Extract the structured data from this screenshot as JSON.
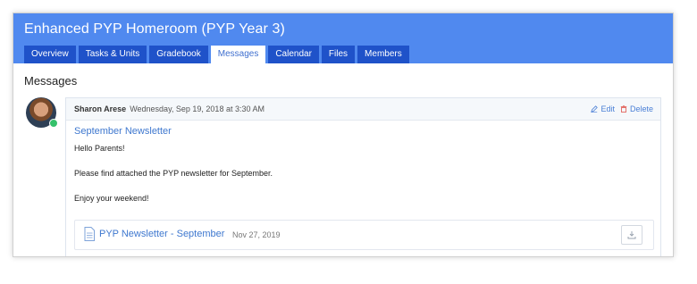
{
  "header": {
    "title": "Enhanced PYP Homeroom (PYP Year 3)",
    "tabs": [
      {
        "label": "Overview",
        "active": false
      },
      {
        "label": "Tasks & Units",
        "active": false
      },
      {
        "label": "Gradebook",
        "active": false
      },
      {
        "label": "Messages",
        "active": true
      },
      {
        "label": "Calendar",
        "active": false
      },
      {
        "label": "Files",
        "active": false
      },
      {
        "label": "Members",
        "active": false
      }
    ]
  },
  "main": {
    "section_title": "Messages",
    "message": {
      "author": "Sharon Arese",
      "timestamp": "Wednesday, Sep 19, 2018 at 3:30 AM",
      "edit_label": "Edit",
      "delete_label": "Delete",
      "subject": "September Newsletter",
      "lines": [
        "Hello Parents!",
        "Please find attached the PYP newsletter for September.",
        "Enjoy your weekend!"
      ],
      "attachment": {
        "name": "PYP Newsletter - September",
        "date": "Nov 27, 2019",
        "icon": "document-icon",
        "action_icon": "download-icon"
      }
    }
  },
  "colors": {
    "header_bg": "#5089ef",
    "tab_bg": "#1f52c9",
    "link": "#3f78cf",
    "online": "#35c16b",
    "delete_icon": "#e0524a"
  }
}
